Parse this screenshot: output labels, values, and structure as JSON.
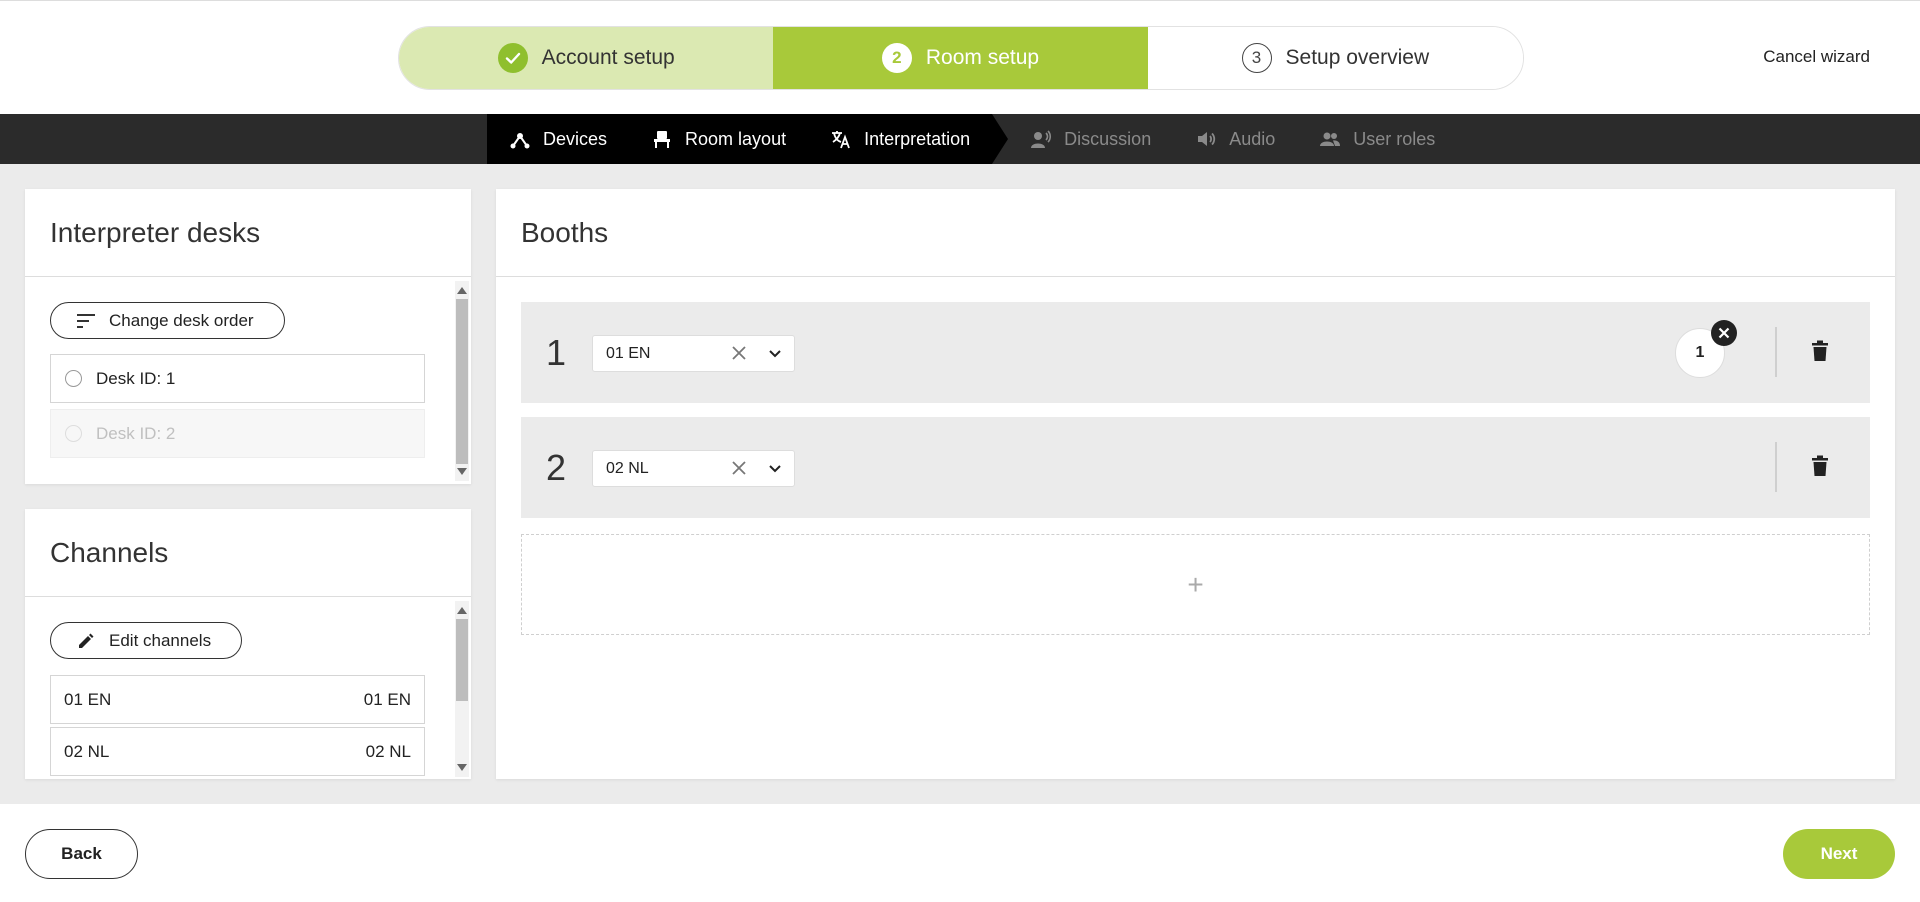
{
  "wizard": {
    "steps": [
      {
        "badge": "",
        "label": "Account setup",
        "state": "done"
      },
      {
        "badge": "2",
        "label": "Room setup",
        "state": "active"
      },
      {
        "badge": "3",
        "label": "Setup overview",
        "state": "todo"
      }
    ],
    "cancel_label": "Cancel wizard"
  },
  "subnav": {
    "tabs": [
      {
        "label": "Devices",
        "icon": "devices-icon",
        "enabled": true
      },
      {
        "label": "Room layout",
        "icon": "chair-icon",
        "enabled": true
      },
      {
        "label": "Interpretation",
        "icon": "translate-icon",
        "enabled": true,
        "active": true
      },
      {
        "label": "Discussion",
        "icon": "discussion-icon",
        "enabled": false
      },
      {
        "label": "Audio",
        "icon": "speaker-icon",
        "enabled": false
      },
      {
        "label": "User roles",
        "icon": "users-icon",
        "enabled": false
      }
    ]
  },
  "interpreter_desks": {
    "title": "Interpreter desks",
    "change_order_label": "Change desk order",
    "desks": [
      {
        "label": "Desk ID: 1",
        "enabled": true
      },
      {
        "label": "Desk ID: 2",
        "enabled": false
      }
    ]
  },
  "channels": {
    "title": "Channels",
    "edit_label": "Edit channels",
    "items": [
      {
        "name": "01 EN",
        "value": "01 EN"
      },
      {
        "name": "02 NL",
        "value": "02 NL"
      }
    ]
  },
  "booths": {
    "title": "Booths",
    "items": [
      {
        "number": "1",
        "channel": "01 EN",
        "desk": "1"
      },
      {
        "number": "2",
        "channel": "02 NL",
        "desk": ""
      }
    ],
    "add_label": "+"
  },
  "footer": {
    "back_label": "Back",
    "next_label": "Next"
  },
  "colors": {
    "accent": "#a8c93a",
    "accent_light": "#dbe9b2",
    "nav_bg": "#2b2b2b"
  }
}
